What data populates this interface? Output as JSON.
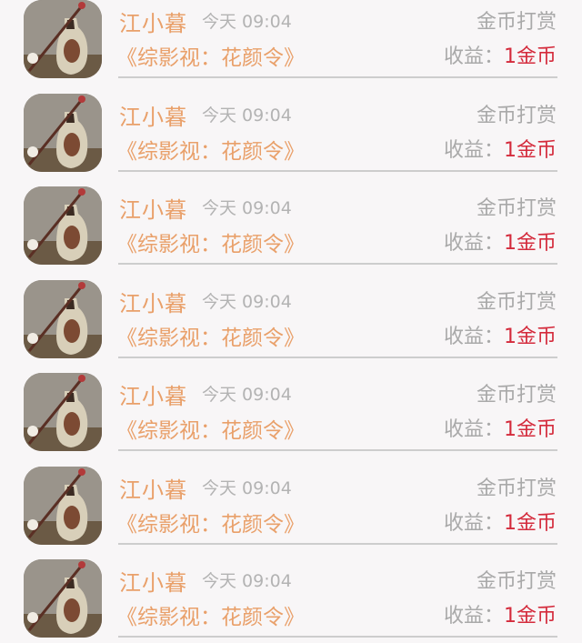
{
  "records": [
    {
      "name": "江小暮",
      "time": "今天 09:04",
      "reward_type": "金币打赏",
      "book": "《综影视：花颜令》",
      "income_label": "收益：",
      "income_amount": "1金币"
    },
    {
      "name": "江小暮",
      "time": "今天 09:04",
      "reward_type": "金币打赏",
      "book": "《综影视：花颜令》",
      "income_label": "收益：",
      "income_amount": "1金币"
    },
    {
      "name": "江小暮",
      "time": "今天 09:04",
      "reward_type": "金币打赏",
      "book": "《综影视：花颜令》",
      "income_label": "收益：",
      "income_amount": "1金币"
    },
    {
      "name": "江小暮",
      "time": "今天 09:04",
      "reward_type": "金币打赏",
      "book": "《综影视：花颜令》",
      "income_label": "收益：",
      "income_amount": "1金币"
    },
    {
      "name": "江小暮",
      "time": "今天 09:04",
      "reward_type": "金币打赏",
      "book": "《综影视：花颜令》",
      "income_label": "收益：",
      "income_amount": "1金币"
    },
    {
      "name": "江小暮",
      "time": "今天 09:04",
      "reward_type": "金币打赏",
      "book": "《综影视：花颜令》",
      "income_label": "收益：",
      "income_amount": "1金币"
    },
    {
      "name": "江小暮",
      "time": "今天 09:04",
      "reward_type": "金币打赏",
      "book": "《综影视：花颜令》",
      "income_label": "收益：",
      "income_amount": "1金币"
    }
  ],
  "colors": {
    "name": "#e9a06a",
    "muted": "#a9a9a9",
    "amount": "#d42b3c",
    "divider": "#cdcdcd"
  }
}
